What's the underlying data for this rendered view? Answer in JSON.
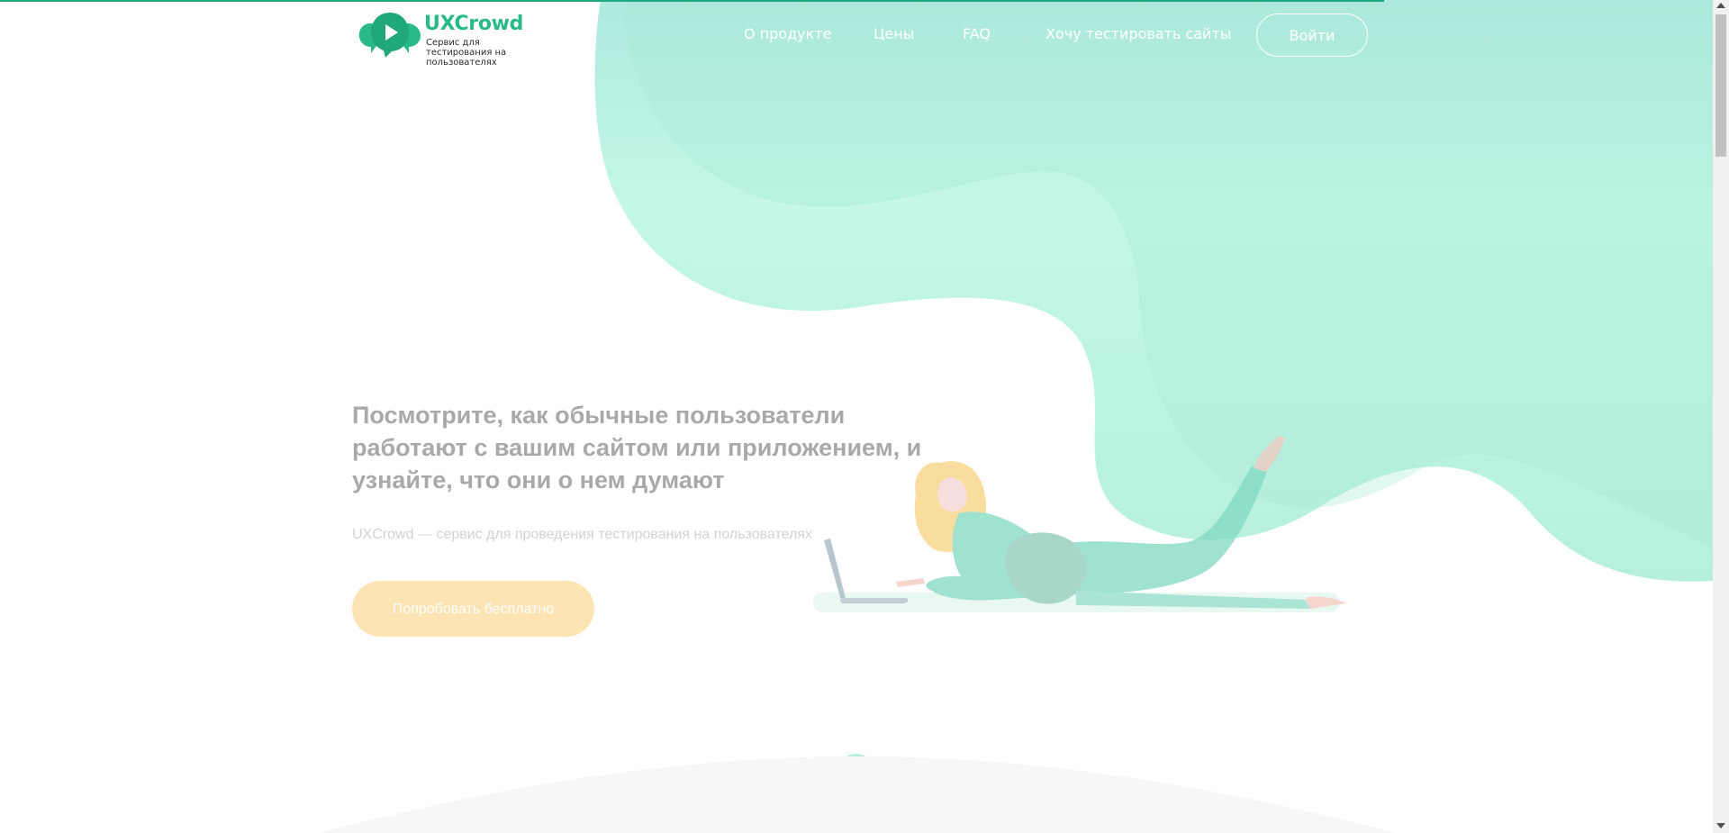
{
  "brand": {
    "name": "UXCrowd",
    "tagline": "Сервис для тестирования на пользователях",
    "accent_color": "#2ab989",
    "blob_color": "#b9f1df"
  },
  "nav": {
    "items": [
      {
        "label": "О продукте"
      },
      {
        "label": "Цены"
      },
      {
        "label": "FAQ"
      },
      {
        "label": "Хочу тестировать сайты"
      }
    ],
    "login_label": "Войти"
  },
  "hero": {
    "title": "Посмотрите, как обычные пользователи работают с вашим сайтом или приложением, и узнайте, что они о нем думают",
    "subtitle": "UXCrowd — сервис для проведения тестирования на пользователях",
    "cta_label": "Попробовать бесплатно",
    "cta_color": "#fde4b4"
  },
  "icons": {
    "logo": "play-bubbles-icon",
    "scroll": "chevron-down-icon"
  }
}
